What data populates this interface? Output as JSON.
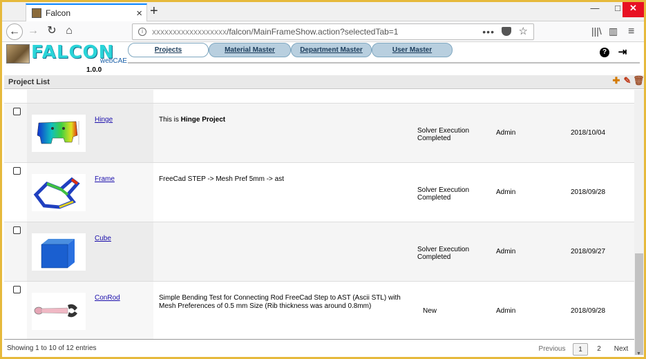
{
  "browser": {
    "tab_title": "Falcon",
    "url_masked": "xxxxxxxxxxxxxxxxxx",
    "url_path": "/falcon/MainFrameShow.action?selectedTab=1",
    "new_tab": "+",
    "minimize": "—",
    "maximize": "□",
    "close": "✕",
    "tab_close": "×",
    "back": "←",
    "forward": "→",
    "reload": "↻",
    "home": "⌂",
    "more": "•••",
    "star": "☆",
    "library": "|||\\",
    "sidebar": "▥",
    "menu": "≡",
    "info": "i"
  },
  "app": {
    "logo_text": "FALCON",
    "logo_sub": "webCAE",
    "version": "1.0.0",
    "help_icon": "?",
    "logout_icon": "⇥",
    "tabs": [
      {
        "label": "Projects",
        "active": true
      },
      {
        "label": "Material Master",
        "active": false
      },
      {
        "label": "Department Master",
        "active": false
      },
      {
        "label": "User Master",
        "active": false
      }
    ]
  },
  "project_list": {
    "title": "Project List",
    "add_icon": "✚",
    "edit_icon": "✎",
    "delete_icon": "🗑",
    "rows": [
      {
        "name": "Hinge",
        "desc_prefix": "This is ",
        "desc_bold": "Hinge Project",
        "desc": "",
        "status": "Solver Execution Completed",
        "owner": "Admin",
        "date": "2018/10/04"
      },
      {
        "name": "Frame",
        "desc_prefix": "",
        "desc_bold": "",
        "desc": "FreeCad STEP -> Mesh Pref 5mm -> ast",
        "status": "Solver Execution Completed",
        "owner": "Admin",
        "date": "2018/09/28"
      },
      {
        "name": "Cube",
        "desc_prefix": "",
        "desc_bold": "",
        "desc": "",
        "status": "Solver Execution Completed",
        "owner": "Admin",
        "date": "2018/09/27"
      },
      {
        "name": "ConRod",
        "desc_prefix": "",
        "desc_bold": "",
        "desc": "Simple Bending Test for Connecting Rod FreeCad Step to AST (Ascii STL) with Mesh Preferences of 0.5 mm Size (Rib thickness was around 0.8mm)",
        "status": "New",
        "owner": "Admin",
        "date": "2018/09/28"
      }
    ]
  },
  "footer": {
    "info": "Showing 1 to 10 of 12 entries",
    "previous": "Previous",
    "page1": "1",
    "page2": "2",
    "next": "Next"
  }
}
